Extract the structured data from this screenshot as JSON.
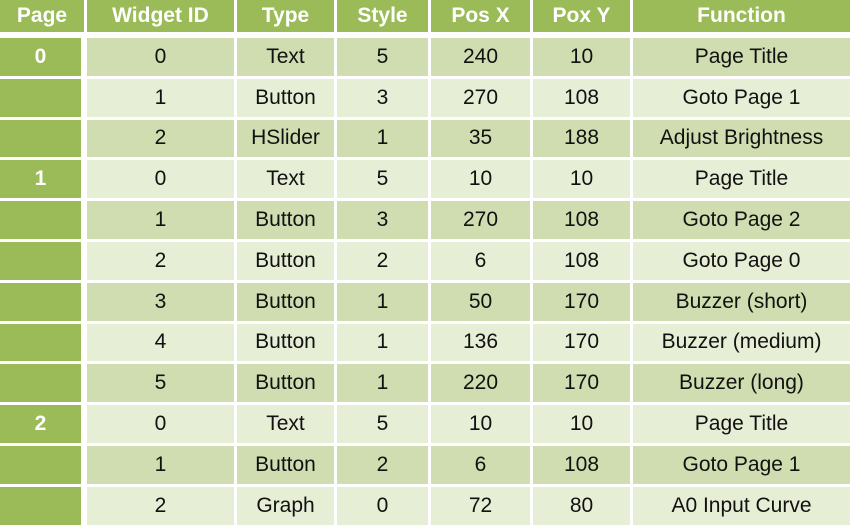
{
  "table": {
    "headers": [
      "Page",
      "Widget ID",
      "Type",
      "Style",
      "Pos X",
      "Pox Y",
      "Function"
    ],
    "rows": [
      {
        "page": "0",
        "widget_id": "0",
        "type": "Text",
        "style": "5",
        "pos_x": "240",
        "pos_y": "10",
        "function": "Page Title"
      },
      {
        "page": "",
        "widget_id": "1",
        "type": "Button",
        "style": "3",
        "pos_x": "270",
        "pos_y": "108",
        "function": "Goto Page 1"
      },
      {
        "page": "",
        "widget_id": "2",
        "type": "HSlider",
        "style": "1",
        "pos_x": "35",
        "pos_y": "188",
        "function": "Adjust Brightness"
      },
      {
        "page": "1",
        "widget_id": "0",
        "type": "Text",
        "style": "5",
        "pos_x": "10",
        "pos_y": "10",
        "function": "Page Title"
      },
      {
        "page": "",
        "widget_id": "1",
        "type": "Button",
        "style": "3",
        "pos_x": "270",
        "pos_y": "108",
        "function": "Goto Page 2"
      },
      {
        "page": "",
        "widget_id": "2",
        "type": "Button",
        "style": "2",
        "pos_x": "6",
        "pos_y": "108",
        "function": "Goto Page 0"
      },
      {
        "page": "",
        "widget_id": "3",
        "type": "Button",
        "style": "1",
        "pos_x": "50",
        "pos_y": "170",
        "function": "Buzzer (short)"
      },
      {
        "page": "",
        "widget_id": "4",
        "type": "Button",
        "style": "1",
        "pos_x": "136",
        "pos_y": "170",
        "function": "Buzzer (medium)"
      },
      {
        "page": "",
        "widget_id": "5",
        "type": "Button",
        "style": "1",
        "pos_x": "220",
        "pos_y": "170",
        "function": "Buzzer (long)"
      },
      {
        "page": "2",
        "widget_id": "0",
        "type": "Text",
        "style": "5",
        "pos_x": "10",
        "pos_y": "10",
        "function": "Page Title"
      },
      {
        "page": "",
        "widget_id": "1",
        "type": "Button",
        "style": "2",
        "pos_x": "6",
        "pos_y": "108",
        "function": "Goto Page 1"
      },
      {
        "page": "",
        "widget_id": "2",
        "type": "Graph",
        "style": "0",
        "pos_x": "72",
        "pos_y": "80",
        "function": "A0 Input Curve"
      }
    ]
  },
  "colors": {
    "header": "#9bbb59",
    "row_dark": "#cfddb0",
    "row_light": "#e6eed6"
  }
}
